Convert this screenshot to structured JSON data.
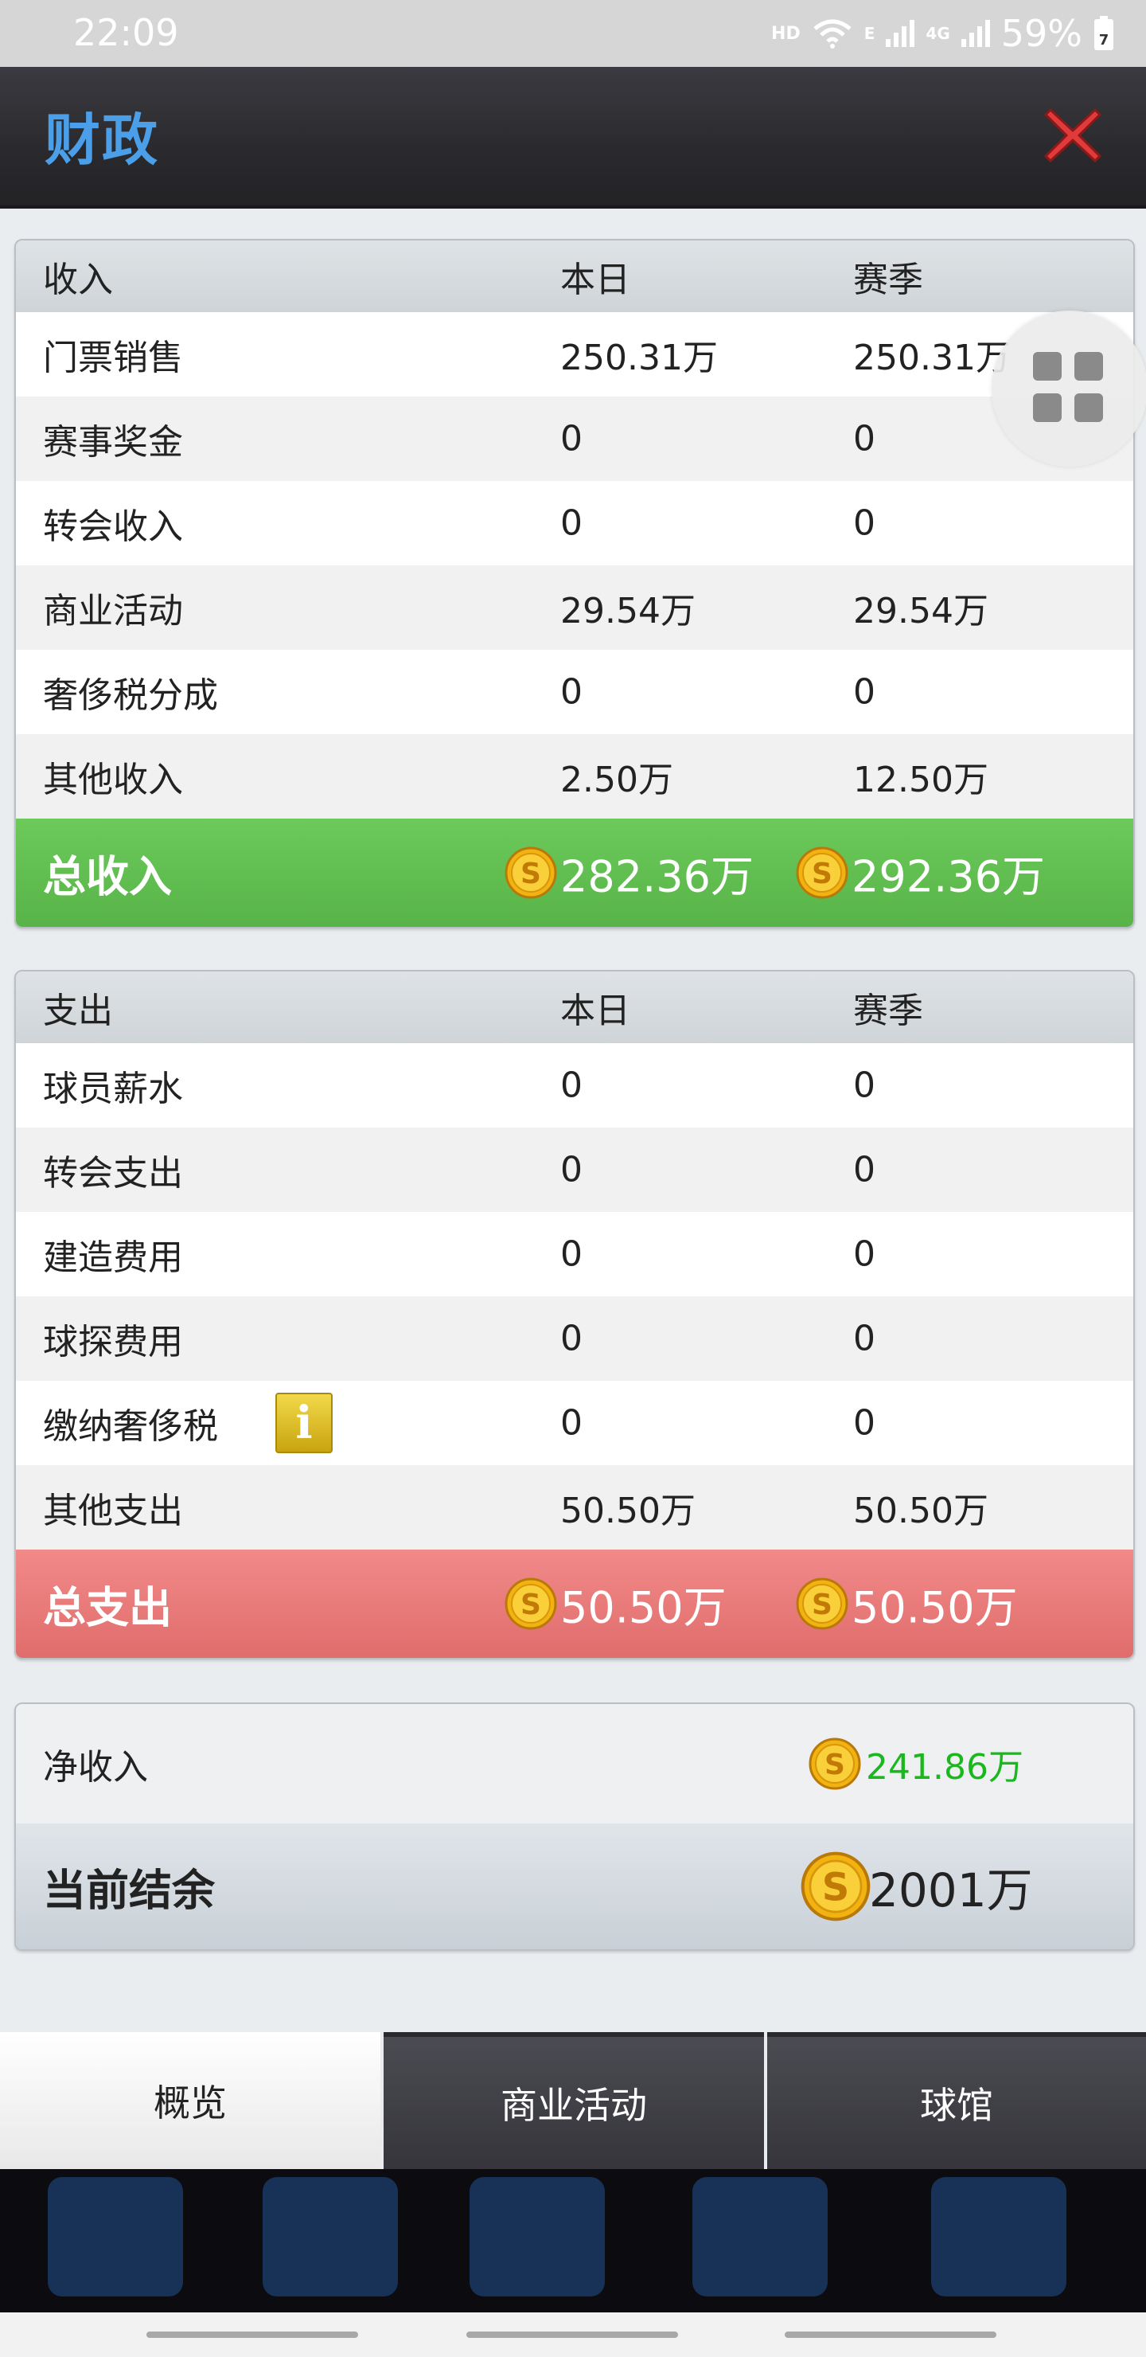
{
  "status_bar": {
    "time": "22:09",
    "hd": "HD",
    "net1": "E",
    "net2": "4G",
    "battery": "59%",
    "battery_badge": "7"
  },
  "header": {
    "title": "财政",
    "close_icon": "close-x-icon"
  },
  "income": {
    "header": [
      "收入",
      "本日",
      "赛季"
    ],
    "rows": [
      [
        "门票销售",
        "250.31万",
        "250.31万"
      ],
      [
        "赛事奖金",
        "0",
        "0"
      ],
      [
        "转会收入",
        "0",
        "0"
      ],
      [
        "商业活动",
        "29.54万",
        "29.54万"
      ],
      [
        "奢侈税分成",
        "0",
        "0"
      ],
      [
        "其他收入",
        "2.50万",
        "12.50万"
      ]
    ],
    "total": {
      "label": "总收入",
      "day": "282.36万",
      "season": "292.36万"
    }
  },
  "expense": {
    "header": [
      "支出",
      "本日",
      "赛季"
    ],
    "rows": [
      [
        "球员薪水",
        "0",
        "0"
      ],
      [
        "转会支出",
        "0",
        "0"
      ],
      [
        "建造费用",
        "0",
        "0"
      ],
      [
        "球探费用",
        "0",
        "0"
      ],
      [
        "缴纳奢侈税",
        "0",
        "0"
      ],
      [
        "其他支出",
        "50.50万",
        "50.50万"
      ]
    ],
    "info_icon_text": "i",
    "total": {
      "label": "总支出",
      "day": "50.50万",
      "season": "50.50万"
    }
  },
  "summary": {
    "net_label": "净收入",
    "net_value": "241.86万",
    "balance_label": "当前结余",
    "balance_value": "2001万"
  },
  "tabs": [
    "概览",
    "商业活动",
    "球馆"
  ],
  "colors": {
    "title_blue": "#4a9fe8",
    "income_green": "#5fbe4f",
    "expense_red": "#e97b7a",
    "net_green": "#1ab81e"
  }
}
